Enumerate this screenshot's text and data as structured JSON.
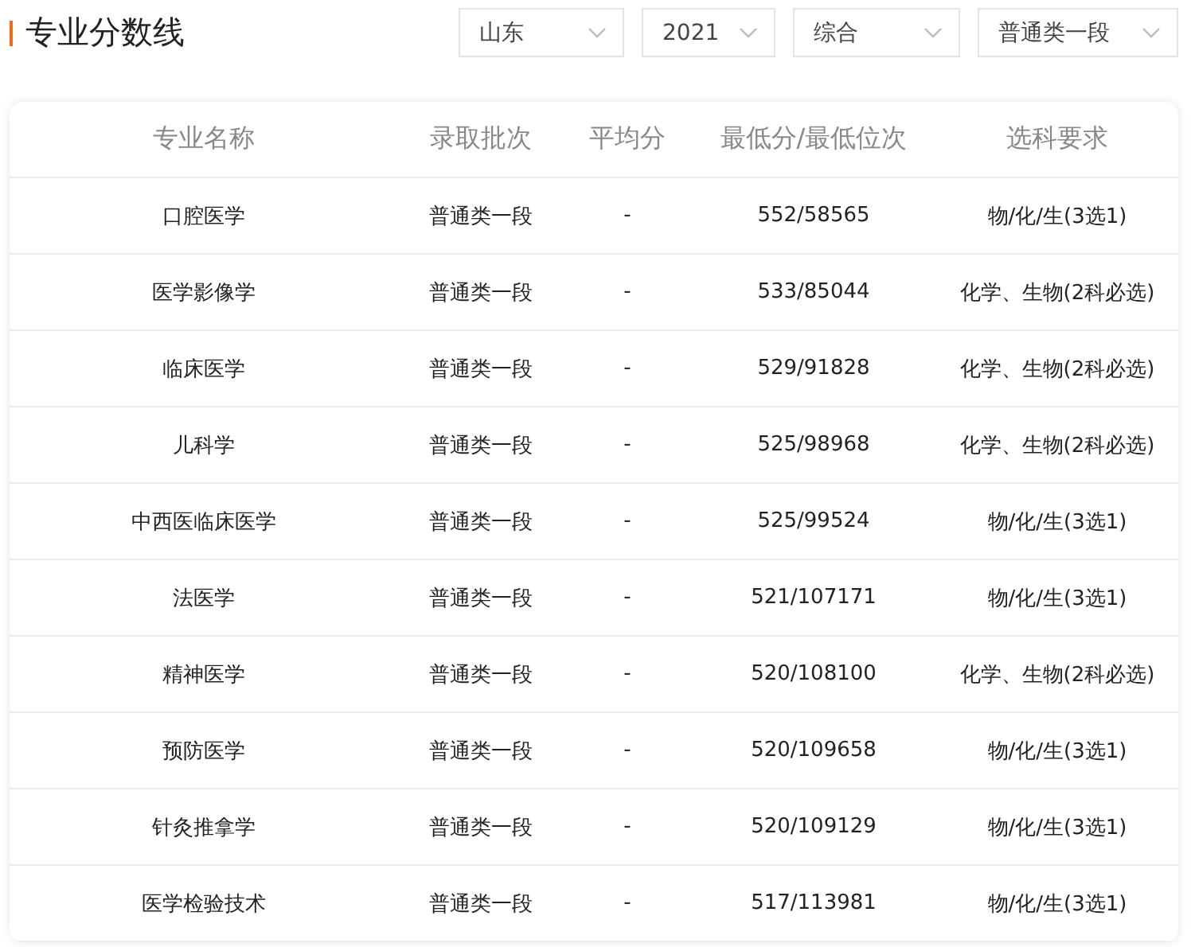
{
  "title": "专业分数线",
  "filters": [
    {
      "value": "山东"
    },
    {
      "value": "2021"
    },
    {
      "value": "综合"
    },
    {
      "value": "普通类一段"
    }
  ],
  "table": {
    "columns": [
      "专业名称",
      "录取批次",
      "平均分",
      "最低分/最低位次",
      "选科要求"
    ],
    "rows": [
      [
        "口腔医学",
        "普通类一段",
        "-",
        "552/58565",
        "物/化/生(3选1)"
      ],
      [
        "医学影像学",
        "普通类一段",
        "-",
        "533/85044",
        "化学、生物(2科必选)"
      ],
      [
        "临床医学",
        "普通类一段",
        "-",
        "529/91828",
        "化学、生物(2科必选)"
      ],
      [
        "儿科学",
        "普通类一段",
        "-",
        "525/98968",
        "化学、生物(2科必选)"
      ],
      [
        "中西医临床医学",
        "普通类一段",
        "-",
        "525/99524",
        "物/化/生(3选1)"
      ],
      [
        "法医学",
        "普通类一段",
        "-",
        "521/107171",
        "物/化/生(3选1)"
      ],
      [
        "精神医学",
        "普通类一段",
        "-",
        "520/108100",
        "化学、生物(2科必选)"
      ],
      [
        "预防医学",
        "普通类一段",
        "-",
        "520/109658",
        "物/化/生(3选1)"
      ],
      [
        "针灸推拿学",
        "普通类一段",
        "-",
        "520/109129",
        "物/化/生(3选1)"
      ],
      [
        "医学检验技术",
        "普通类一段",
        "-",
        "517/113981",
        "物/化/生(3选1)"
      ]
    ]
  }
}
